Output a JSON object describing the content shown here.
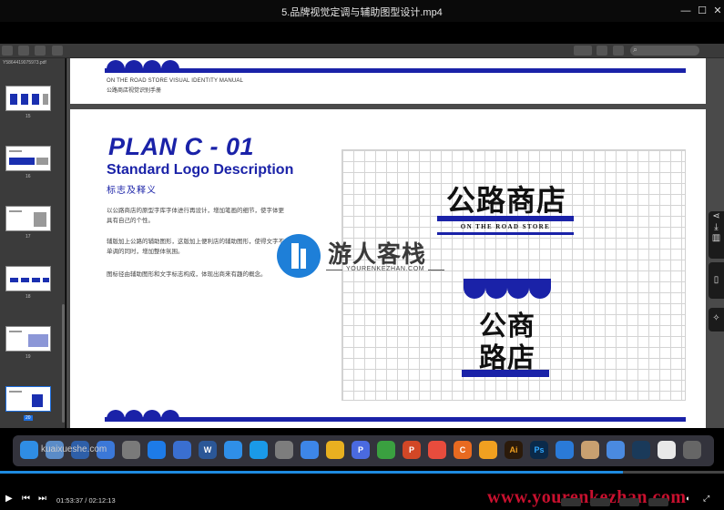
{
  "window": {
    "title": "5.品牌视觉定调与辅助图型设计.mp4",
    "minimize": "—",
    "maximize": "☐",
    "close": "✕"
  },
  "sidebar": {
    "file_name": "Y5864419075973.pdf",
    "thumbnails": [
      {
        "page": "15",
        "active": false
      },
      {
        "page": "16",
        "active": false
      },
      {
        "page": "17",
        "active": false
      },
      {
        "page": "18",
        "active": false
      },
      {
        "page": "19",
        "active": false
      },
      {
        "page": "20",
        "active": true
      }
    ]
  },
  "page_top": {
    "manual_en": "ON THE ROAD STORE VISUAL IDENTITY MANUAL",
    "manual_cn": "公路商店视觉识别手册"
  },
  "page_main": {
    "heading": "PLAN C - 01",
    "sub_en": "Standard Logo Description",
    "sub_cn": "标志及释义",
    "paragraphs": [
      "以公路商店的原型字库字体进行再设计，增加笔画的细节，使字体更具有自己的个性。",
      "辅版加上公路的辅助图形，这版加上便利店的辅助图形，使得文字不单调的同时，增加整体氛围。",
      "图标径由辅助图形和文字标志构成，体现出商来有趣的概念。"
    ],
    "logo_horizontal": "公路商店",
    "logo_en": "ON THE ROAD STORE",
    "logo_vertical_line1": "公商",
    "logo_vertical_line2": "路店"
  },
  "watermark": {
    "text": "游人客栈",
    "sub": "YOURENKEZHAN.COM"
  },
  "dock": {
    "overlay_text": "kuaixueshe.com",
    "icons": [
      {
        "name": "finder",
        "label": "",
        "color": "#2f8de4"
      },
      {
        "name": "system",
        "label": "",
        "color": "#5b8cc8"
      },
      {
        "name": "stats",
        "label": "",
        "color": "#2e5fa8"
      },
      {
        "name": "shield",
        "label": "",
        "color": "#3b78d8"
      },
      {
        "name": "launch",
        "label": "",
        "color": "#7a7a7a"
      },
      {
        "name": "appstore",
        "label": "",
        "color": "#1d7be8"
      },
      {
        "name": "keynote",
        "label": "",
        "color": "#3a6fd0"
      },
      {
        "name": "word",
        "label": "W",
        "color": "#2b5797"
      },
      {
        "name": "safari",
        "label": "",
        "color": "#2f8fe8"
      },
      {
        "name": "qq",
        "label": "",
        "color": "#1a9ae8"
      },
      {
        "name": "prefs",
        "label": "",
        "color": "#7d7d7d"
      },
      {
        "name": "feishu",
        "label": "",
        "color": "#3d86e8"
      },
      {
        "name": "chrome",
        "label": "",
        "color": "#e8b020"
      },
      {
        "name": "pdfpro",
        "label": "P",
        "color": "#4a6ae0"
      },
      {
        "name": "wechat",
        "label": "",
        "color": "#3aa040"
      },
      {
        "name": "ppt",
        "label": "P",
        "color": "#d24726"
      },
      {
        "name": "google",
        "label": "",
        "color": "#e84c3d"
      },
      {
        "name": "c4d",
        "label": "C",
        "color": "#e86a20"
      },
      {
        "name": "sketch",
        "label": "",
        "color": "#f0a020"
      },
      {
        "name": "ai",
        "label": "Ai",
        "color": "#2b1a0a"
      },
      {
        "name": "ps",
        "label": "Ps",
        "color": "#0a2a4a"
      },
      {
        "name": "mountain",
        "label": "",
        "color": "#2a7ad8"
      },
      {
        "name": "preview",
        "label": "",
        "color": "#c8a070"
      },
      {
        "name": "files",
        "label": "",
        "color": "#4a8ae0"
      },
      {
        "name": "steam",
        "label": "",
        "color": "#1a3a5a"
      },
      {
        "name": "note",
        "label": "",
        "color": "#e8e8e8"
      },
      {
        "name": "trash",
        "label": "",
        "color": "#666"
      }
    ]
  },
  "player": {
    "time": "01:53:37 / 02:12:13",
    "progress": 0.86,
    "site": "www.yourenkezhan.com"
  },
  "colors": {
    "brand_blue": "#1a22a8"
  }
}
